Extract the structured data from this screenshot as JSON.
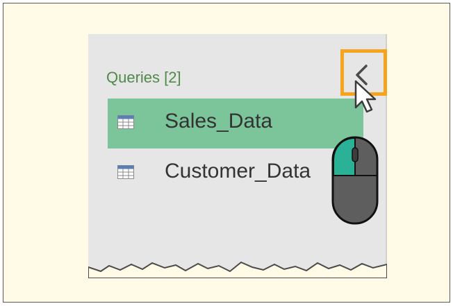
{
  "queries_panel": {
    "title": "Queries [2]",
    "items": [
      {
        "label": "Sales_Data",
        "selected": true,
        "icon": "table-icon"
      },
      {
        "label": "Customer_Data",
        "selected": false,
        "icon": "table-icon"
      }
    ],
    "collapse_icon": "chevron-left-icon"
  },
  "colors": {
    "frame_background": "#fffbe6",
    "panel_background": "#e6e6e6",
    "title_color": "#4f8a49",
    "selected_row": "#7cc59a",
    "highlight_box": "#f4a51d",
    "mouse_body": "#5e5e5e",
    "mouse_button": "#2bb196"
  }
}
